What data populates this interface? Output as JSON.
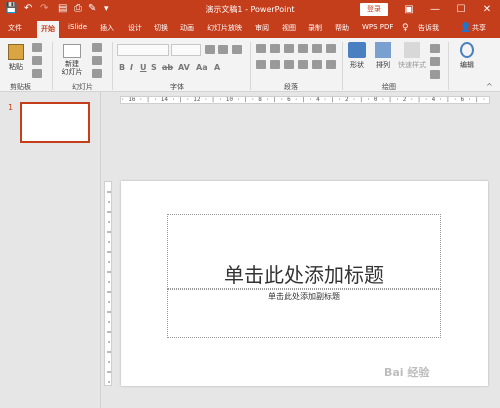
{
  "titlebar": {
    "title": "演示文稿1  -  PowerPoint",
    "login_label": "登录",
    "save_icon": "save-icon",
    "undo_icon": "undo-icon",
    "redo_icon": "redo-icon"
  },
  "tabs": [
    {
      "label": "文件"
    },
    {
      "label": "开始"
    },
    {
      "label": "iSlide"
    },
    {
      "label": "插入"
    },
    {
      "label": "设计"
    },
    {
      "label": "切换"
    },
    {
      "label": "动画"
    },
    {
      "label": "幻灯片放映"
    },
    {
      "label": "审阅"
    },
    {
      "label": "视图"
    },
    {
      "label": "录制"
    },
    {
      "label": "帮助"
    },
    {
      "label": "WPS PDF"
    },
    {
      "label": "告诉我"
    }
  ],
  "share_label": "共享",
  "ribbon": {
    "paste_label": "粘贴",
    "new_slide_label": "新建\n幻灯片",
    "shape_label": "形状",
    "arrange_label": "排列",
    "quick_style_label": "快速样式",
    "edit_label": "编辑",
    "groups": {
      "clipboard": "剪贴板",
      "slides": "幻灯片",
      "font": "字体",
      "paragraph": "段落",
      "drawing": "绘图"
    }
  },
  "thumbnail": {
    "number": "1"
  },
  "ruler": {
    "h_text": "· 16 · | · 14 · | · 12 · | · 10 · | · 8 · | · 6 · | · 4 · | · 2 · | · 0 · | · 2 · | · 4 · | · 6 · | · 8 · | · 10 · | · 12 · | · 14 · | · 16 ·"
  },
  "slide": {
    "title_placeholder": "单击此处添加标题",
    "subtitle_placeholder": "单击此处添加副标题"
  },
  "watermark": "Bai 经验",
  "colors": {
    "accent": "#c43e1c"
  }
}
